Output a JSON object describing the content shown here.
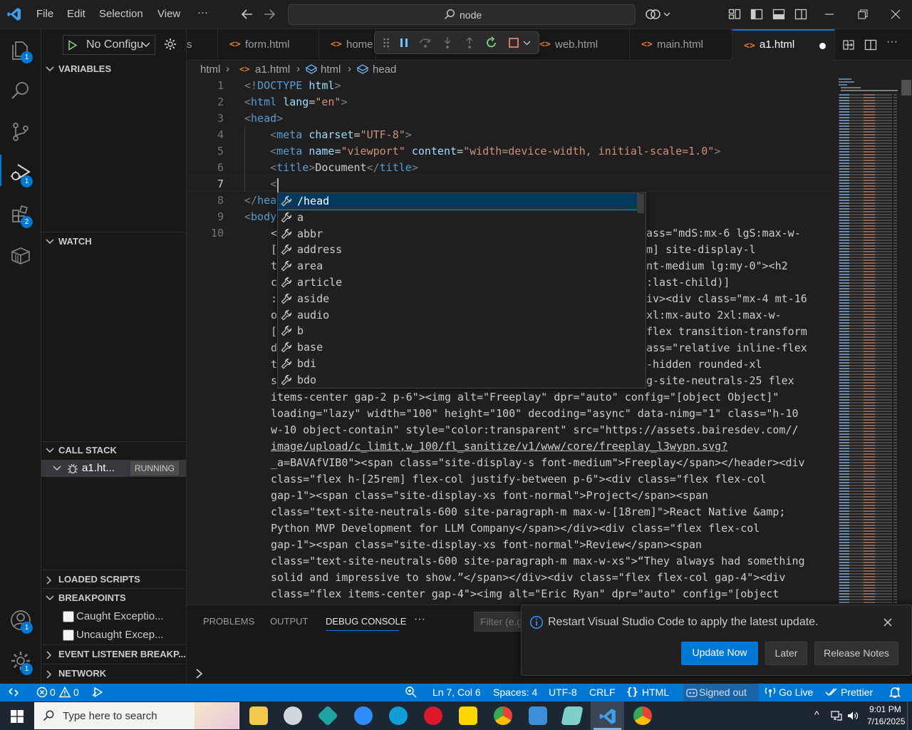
{
  "menu": {
    "file": "File",
    "edit": "Edit",
    "selection": "Selection",
    "view": "View",
    "more": "···"
  },
  "command_center": {
    "label": "node"
  },
  "activity_badges": {
    "explorer": "1",
    "run": "1",
    "extensions": "2",
    "accounts": "1",
    "manage": "1"
  },
  "sidebar": {
    "run_config": "No Configu",
    "variables": "VARIABLES",
    "watch": "WATCH",
    "call_stack": "CALL STACK",
    "call_stack_item": "a1.ht...",
    "call_stack_status": "RUNNING",
    "loaded_scripts": "LOADED SCRIPTS",
    "breakpoints": "BREAKPOINTS",
    "bp_caught": "Caught Exceptio...",
    "bp_uncaught": "Uncaught Excep...",
    "event_listener": "EVENT LISTENER BREAKP...",
    "network": "NETWORK"
  },
  "tabs": [
    {
      "label": "s"
    },
    {
      "label": "form.html"
    },
    {
      "label": "home"
    },
    {
      "label": "web.html"
    },
    {
      "label": "main.html"
    },
    {
      "label": "a1.html"
    }
  ],
  "breadcrumb": {
    "p1": "html",
    "p2": "a1.html",
    "p3": "html",
    "p4": "head"
  },
  "editor": {
    "line_numbers": [
      "1",
      "2",
      "3",
      "4",
      "5",
      "6",
      "7",
      "8",
      "9",
      "10"
    ],
    "wrap_lines": [
      "items-center gap-2 p-6\"><img alt=\"Freeplay\" dpr=\"auto\" config=\"[object Object]\"",
      "loading=\"lazy\" width=\"100\" height=\"100\" decoding=\"async\" data-nimg=\"1\" class=\"h-10",
      "w-10 object-contain\" style=\"color:transparent\" src=\"https://assets.bairesdev.com//",
      "image/upload/c_limit,w_100/fl_sanitize/v1/www/core/freeplay_l3wypn.svg?",
      "_a=BAVAfVIB0\"><span class=\"site-display-s font-medium\">Freeplay</span></header><div",
      "class=\"flex h-[25rem] flex-col justify-between p-6\"><div class=\"flex flex-col",
      "gap-1\"><span class=\"site-display-xs font-normal\">Project</span><span",
      "class=\"text-site-neutrals-600 site-paragraph-m max-w-[18rem]\">React Native &amp;",
      "Python MVP Development for LLM Company</span></div><div class=\"flex flex-col",
      "gap-1\"><span class=\"site-display-xs font-normal\">Review</span><span",
      "class=\"text-site-neutrals-600 site-paragraph-m max-w-xs\">“They always had something",
      "solid and impressive to show.”</span></div><div class=\"flex flex-col gap-4\"><div",
      "class=\"flex items-center gap-4\"><img alt=\"Eric Ryan\" dpr=\"auto\" config=\"[object"
    ],
    "line10_left": [
      "<",
      "[",
      "t",
      "c",
      ":",
      "o",
      "[",
      "d",
      "t",
      "s"
    ],
    "line10_right": [
      "ass=\"mdS:mx-6 lgS:max-w-",
      "m] site-display-l",
      "nt-medium lg:my-0\"><h2",
      ":last-child)]",
      "iv><div class=\"mx-4 mt-16",
      "xl:mx-auto 2xl:max-w-",
      "flex transition-transform",
      "ass=\"relative inline-flex",
      "-hidden rounded-xl",
      "g-site-neutrals-25 flex"
    ]
  },
  "suggest": [
    "/head",
    "a",
    "abbr",
    "address",
    "area",
    "article",
    "aside",
    "audio",
    "b",
    "base",
    "bdi",
    "bdo"
  ],
  "panel": {
    "problems": "PROBLEMS",
    "output": "OUTPUT",
    "debug_console": "DEBUG CONSOLE",
    "more": "···",
    "filter_placeholder": "Filter (e.g"
  },
  "notification": {
    "message": "Restart Visual Studio Code to apply the latest update.",
    "update_now": "Update Now",
    "later": "Later",
    "release_notes": "Release Notes"
  },
  "status": {
    "errors": "0",
    "warnings": "0",
    "position": "Ln 7, Col 6",
    "spaces": "Spaces: 4",
    "encoding": "UTF-8",
    "eol": "CRLF",
    "language": "HTML",
    "signed_out": "Signed out",
    "go_live": "Go Live",
    "prettier": "Prettier"
  },
  "taskbar": {
    "search_placeholder": "Type here to search",
    "time": "9:01 PM",
    "date": "7/16/2025"
  },
  "colors": {
    "accent": "#0078d4",
    "tag": "#569cd6",
    "attr": "#9cdcfe",
    "string": "#ce9178",
    "html_icon": "#e37933"
  }
}
